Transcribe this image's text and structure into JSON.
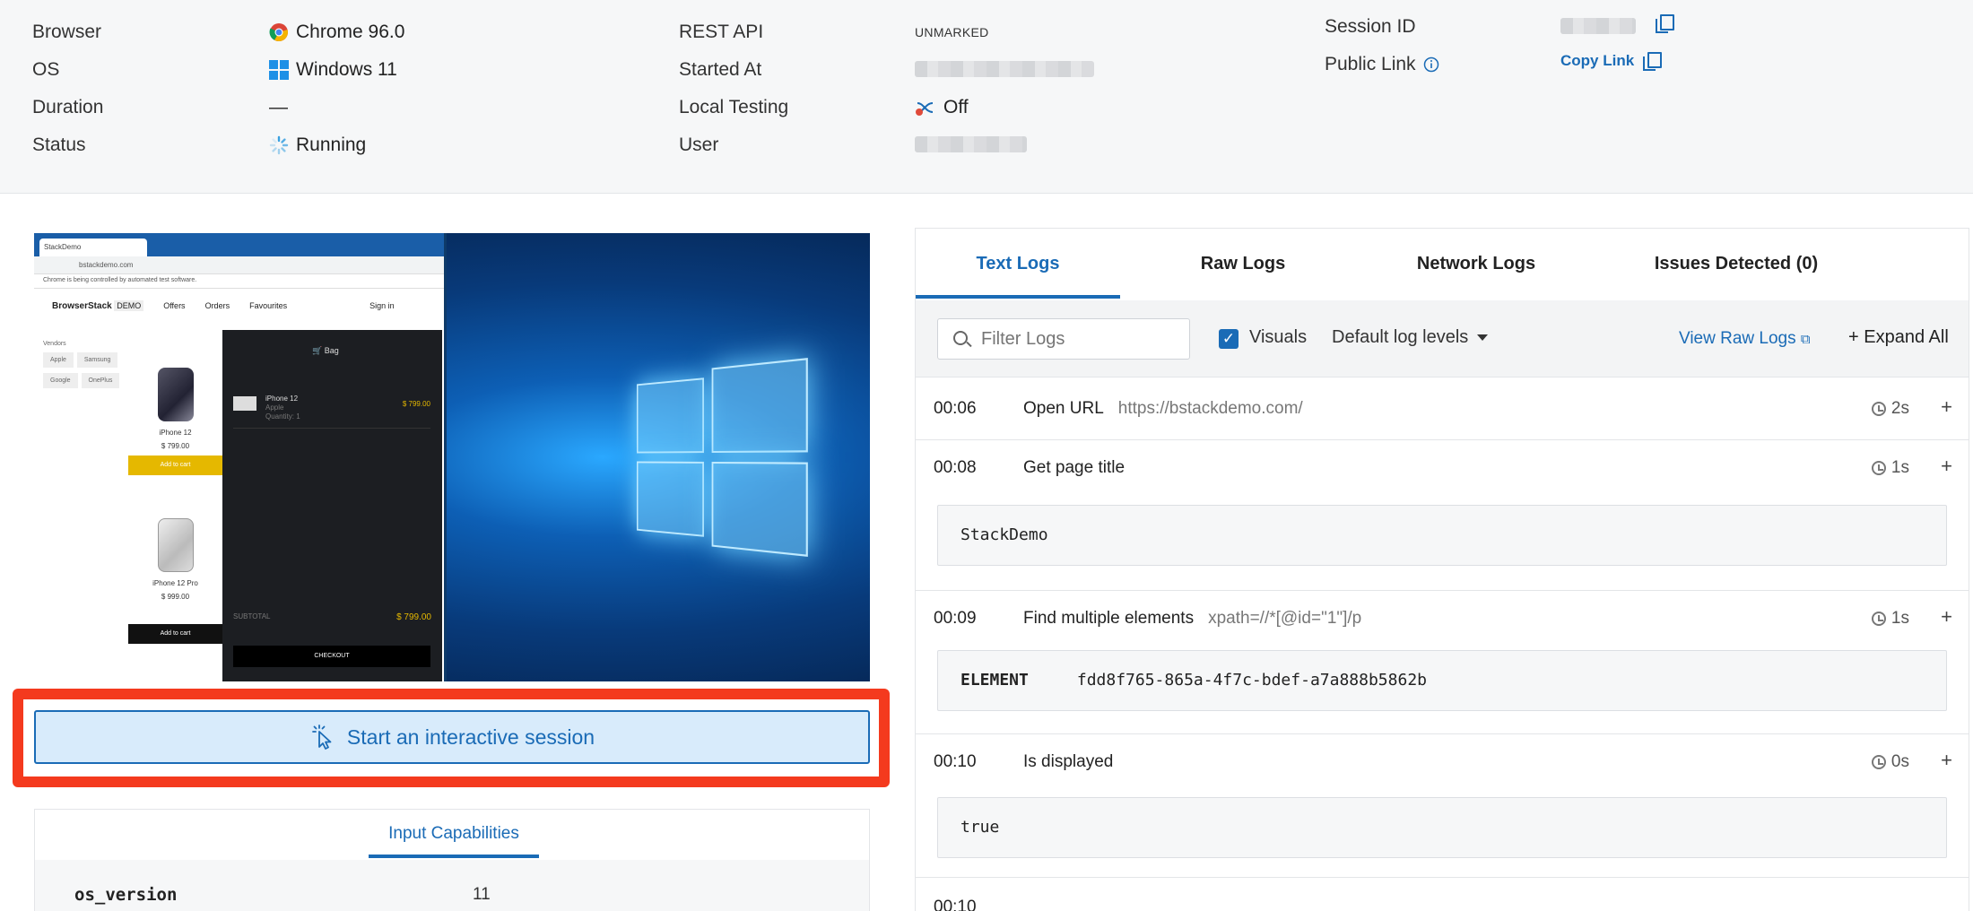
{
  "info": {
    "browser_label": "Browser",
    "browser_value": "Chrome 96.0",
    "os_label": "OS",
    "os_value": "Windows 11",
    "duration_label": "Duration",
    "duration_value": "—",
    "status_label": "Status",
    "status_value": "Running",
    "rest_api_label": "REST API",
    "rest_api_value": "UNMARKED",
    "started_at_label": "Started At",
    "local_testing_label": "Local Testing",
    "local_testing_value": "Off",
    "user_label": "User",
    "session_id_label": "Session ID",
    "public_link_label": "Public Link",
    "copy_link": "Copy Link"
  },
  "preview": {
    "tab_title": "StackDemo",
    "address": "bstackdemo.com",
    "warning": "Chrome is being controlled by automated test software.",
    "nav": [
      "Offers",
      "Orders",
      "Favourites"
    ],
    "signin": "Sign in",
    "logo": "BrowserStack",
    "logo_badge": "DEMO",
    "vendors_label": "Vendors",
    "vendors": [
      "Apple",
      "Samsung",
      "Google",
      "OnePlus"
    ],
    "products": [
      {
        "name": "iPhone 12",
        "price": "$ 799.00",
        "button": "Add to cart"
      },
      {
        "name": "iPhone 12 Pro",
        "price": "$ 999.00",
        "button": "Add to cart"
      }
    ],
    "bag_title": "Bag",
    "bag_item_name": "iPhone 12",
    "bag_item_vendor": "Apple",
    "bag_item_qty": "Quantity: 1",
    "bag_item_price": "$ 799.00",
    "subtotal_label": "SUBTOTAL",
    "subtotal_value": "$ 799.00",
    "checkout": "CHECKOUT"
  },
  "interactive_session": "Start an interactive session",
  "capabilities": {
    "tab": "Input Capabilities",
    "rows": [
      {
        "key": "os_version",
        "value": "11"
      }
    ]
  },
  "logs": {
    "tabs": [
      "Text Logs",
      "Raw Logs",
      "Network Logs",
      "Issues Detected (0)"
    ],
    "filter_placeholder": "Filter Logs",
    "visuals_label": "Visuals",
    "log_levels": "Default log levels",
    "view_raw": "View Raw Logs",
    "expand_all": "Expand All",
    "entries": [
      {
        "time": "00:06",
        "command": "Open URL",
        "arg": "https://bstackdemo.com/",
        "duration": "2s"
      },
      {
        "time": "00:08",
        "command": "Get page title",
        "arg": "",
        "duration": "1s",
        "output": "StackDemo"
      },
      {
        "time": "00:09",
        "command": "Find multiple elements",
        "arg": "xpath=//*[@id=\"1\"]/p",
        "duration": "1s",
        "output_key": "ELEMENT",
        "output": "fdd8f765-865a-4f7c-bdef-a7a888b5862b"
      },
      {
        "time": "00:10",
        "command": "Is displayed",
        "arg": "",
        "duration": "0s",
        "output": "true"
      }
    ]
  }
}
